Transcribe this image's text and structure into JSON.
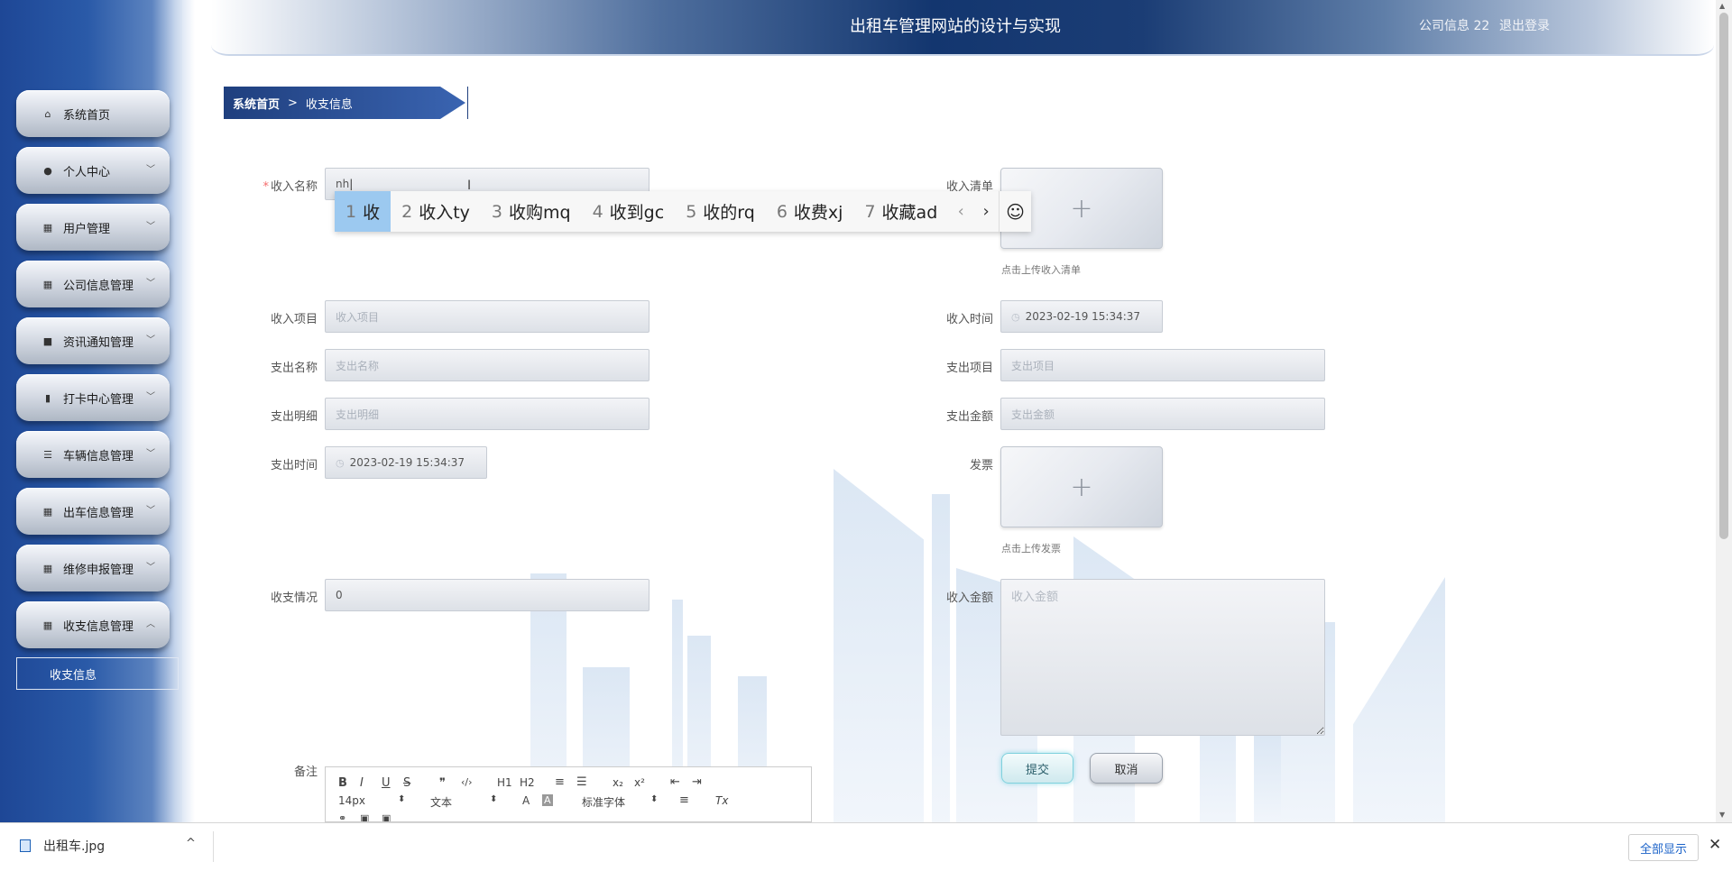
{
  "header": {
    "title": "出租车管理网站的设计与实现",
    "user": "公司信息 22",
    "logout": "退出登录"
  },
  "breadcrumb": {
    "home": "系统首页",
    "separator": ">",
    "current": "收支信息"
  },
  "sidebar": {
    "items": [
      {
        "label": "系统首页",
        "icon": "home-icon",
        "has_chevron": false
      },
      {
        "label": "个人中心",
        "icon": "user-icon",
        "has_chevron": true
      },
      {
        "label": "用户管理",
        "icon": "grid-icon",
        "has_chevron": true
      },
      {
        "label": "公司信息管理",
        "icon": "grid-icon",
        "has_chevron": true
      },
      {
        "label": "资讯通知管理",
        "icon": "briefcase-icon",
        "has_chevron": true
      },
      {
        "label": "打卡中心管理",
        "icon": "bar-chart-icon",
        "has_chevron": true
      },
      {
        "label": "车辆信息管理",
        "icon": "sliders-icon",
        "has_chevron": true
      },
      {
        "label": "出车信息管理",
        "icon": "grid-icon",
        "has_chevron": true
      },
      {
        "label": "维修申报管理",
        "icon": "grid-icon",
        "has_chevron": true
      },
      {
        "label": "收支信息管理",
        "icon": "grid-icon",
        "has_chevron": true,
        "expanded": true
      }
    ],
    "sub_item": "收支信息"
  },
  "form": {
    "income_name": {
      "label": "收入名称",
      "required": true,
      "value": "nh"
    },
    "income_list": {
      "label": "收入清单",
      "hint": "点击上传收入清单"
    },
    "income_item": {
      "label": "收入项目",
      "placeholder": "收入项目"
    },
    "income_time": {
      "label": "收入时间",
      "value": "2023-02-19 15:34:37"
    },
    "expense_name": {
      "label": "支出名称",
      "placeholder": "支出名称"
    },
    "expense_item": {
      "label": "支出项目",
      "placeholder": "支出项目"
    },
    "expense_detail": {
      "label": "支出明细",
      "placeholder": "支出明细"
    },
    "expense_amount": {
      "label": "支出金额",
      "placeholder": "支出金额"
    },
    "expense_time": {
      "label": "支出时间",
      "value": "2023-02-19 15:34:37"
    },
    "invoice": {
      "label": "发票",
      "hint": "点击上传发票"
    },
    "balance_status": {
      "label": "收支情况",
      "value": "0"
    },
    "income_amount": {
      "label": "收入金额",
      "placeholder": "收入金额"
    },
    "remark": {
      "label": "备注"
    },
    "upload_plus": "+"
  },
  "buttons": {
    "submit": "提交",
    "cancel": "取消"
  },
  "ime": {
    "candidates": [
      {
        "num": "1",
        "text": "收"
      },
      {
        "num": "2",
        "text": "收入ty"
      },
      {
        "num": "3",
        "text": "收购mq"
      },
      {
        "num": "4",
        "text": "收到gc"
      },
      {
        "num": "5",
        "text": "收的rq"
      },
      {
        "num": "6",
        "text": "收费xj"
      },
      {
        "num": "7",
        "text": "收藏ad"
      }
    ],
    "prev": "‹",
    "next": "›",
    "emoji": "☺"
  },
  "editor": {
    "bold": "B",
    "italic": "I",
    "underline": "U",
    "strike": "S",
    "quote": "❞",
    "code": "‹/›",
    "h1": "H1",
    "h2": "H2",
    "ordered": "≡",
    "bullet": "☰",
    "sub": "x₂",
    "sup": "x²",
    "outdent": "⇤",
    "indent": "⇥",
    "font_size": "14px",
    "text_style": "文本",
    "font_family": "标准字体",
    "align": "≡",
    "clear": "Tx"
  },
  "download_bar": {
    "file_name": "出租车.jpg",
    "show_all": "全部显示",
    "close": "✕",
    "chevron": "^"
  },
  "colors": {
    "sidebar_blue": "#1e4796",
    "header_navy": "#13366f",
    "required_star": "#f56c6c",
    "ime_selected": "#9cc9f0"
  }
}
